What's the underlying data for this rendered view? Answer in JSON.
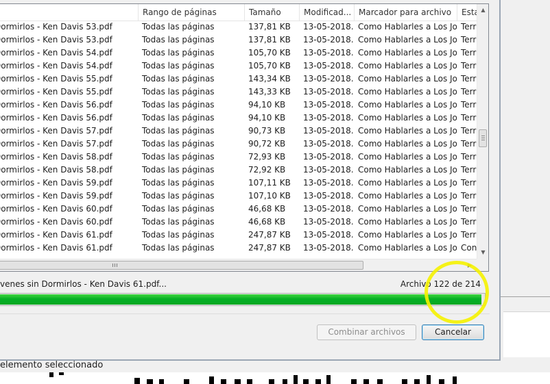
{
  "columns": [
    {
      "label": ""
    },
    {
      "label": "Rango de páginas"
    },
    {
      "label": "Tamaño"
    },
    {
      "label": "Modificad..."
    },
    {
      "label": "Marcador para archivo"
    },
    {
      "label": "Esta"
    }
  ],
  "rows": [
    {
      "name": "Dormirlos - Ken Davis 53.pdf",
      "range": "Todas las páginas",
      "size": "137,81 KB",
      "modified": "13-05-2018...",
      "bookmark": "Como Hablarles a Los Jo...",
      "state": "Terr"
    },
    {
      "name": "Dormirlos - Ken Davis 53.pdf",
      "range": "Todas las páginas",
      "size": "137,81 KB",
      "modified": "13-05-2018...",
      "bookmark": "Como Hablarles a Los Jo...",
      "state": "Terr"
    },
    {
      "name": "Dormirlos - Ken Davis 54.pdf",
      "range": "Todas las páginas",
      "size": "105,70 KB",
      "modified": "13-05-2018...",
      "bookmark": "Como Hablarles a Los Jo...",
      "state": "Terr"
    },
    {
      "name": "Dormirlos - Ken Davis 54.pdf",
      "range": "Todas las páginas",
      "size": "105,70 KB",
      "modified": "13-05-2018...",
      "bookmark": "Como Hablarles a Los Jo...",
      "state": "Terr"
    },
    {
      "name": "Dormirlos - Ken Davis 55.pdf",
      "range": "Todas las páginas",
      "size": "143,34 KB",
      "modified": "13-05-2018...",
      "bookmark": "Como Hablarles a Los Jo...",
      "state": "Terr"
    },
    {
      "name": "Dormirlos - Ken Davis 55.pdf",
      "range": "Todas las páginas",
      "size": "143,33 KB",
      "modified": "13-05-2018...",
      "bookmark": "Como Hablarles a Los Jo...",
      "state": "Terr"
    },
    {
      "name": "Dormirlos - Ken Davis 56.pdf",
      "range": "Todas las páginas",
      "size": "94,10 KB",
      "modified": "13-05-2018...",
      "bookmark": "Como Hablarles a Los Jo...",
      "state": "Terr"
    },
    {
      "name": "Dormirlos - Ken Davis 56.pdf",
      "range": "Todas las páginas",
      "size": "94,10 KB",
      "modified": "13-05-2018...",
      "bookmark": "Como Hablarles a Los Jo...",
      "state": "Terr"
    },
    {
      "name": "Dormirlos - Ken Davis 57.pdf",
      "range": "Todas las páginas",
      "size": "90,73 KB",
      "modified": "13-05-2018...",
      "bookmark": "Como Hablarles a Los Jo...",
      "state": "Terr"
    },
    {
      "name": "Dormirlos - Ken Davis 57.pdf",
      "range": "Todas las páginas",
      "size": "90,72 KB",
      "modified": "13-05-2018...",
      "bookmark": "Como Hablarles a Los Jo...",
      "state": "Terr"
    },
    {
      "name": "Dormirlos - Ken Davis 58.pdf",
      "range": "Todas las páginas",
      "size": "72,93 KB",
      "modified": "13-05-2018...",
      "bookmark": "Como Hablarles a Los Jo...",
      "state": "Terr"
    },
    {
      "name": "Dormirlos - Ken Davis 58.pdf",
      "range": "Todas las páginas",
      "size": "72,92 KB",
      "modified": "13-05-2018...",
      "bookmark": "Como Hablarles a Los Jo...",
      "state": "Terr"
    },
    {
      "name": "Dormirlos - Ken Davis 59.pdf",
      "range": "Todas las páginas",
      "size": "107,11 KB",
      "modified": "13-05-2018...",
      "bookmark": "Como Hablarles a Los Jo...",
      "state": "Terr"
    },
    {
      "name": "Dormirlos - Ken Davis 59.pdf",
      "range": "Todas las páginas",
      "size": "107,10 KB",
      "modified": "13-05-2018...",
      "bookmark": "Como Hablarles a Los Jo...",
      "state": "Terr"
    },
    {
      "name": "Dormirlos - Ken Davis 60.pdf",
      "range": "Todas las páginas",
      "size": "46,68 KB",
      "modified": "13-05-2018...",
      "bookmark": "Como Hablarles a Los Jo...",
      "state": "Terr"
    },
    {
      "name": "Dormirlos - Ken Davis 60.pdf",
      "range": "Todas las páginas",
      "size": "46,68 KB",
      "modified": "13-05-2018...",
      "bookmark": "Como Hablarles a Los Jo...",
      "state": "Terr"
    },
    {
      "name": "Dormirlos - Ken Davis 61.pdf",
      "range": "Todas las páginas",
      "size": "247,87 KB",
      "modified": "13-05-2018...",
      "bookmark": "Como Hablarles a Los Jo...",
      "state": "Terr"
    },
    {
      "name": "Dormirlos - Ken Davis 61.pdf",
      "range": "Todas las páginas",
      "size": "247,87 KB",
      "modified": "13-05-2018...",
      "bookmark": "Como Hablarles a Los Jo...",
      "state": "Con"
    }
  ],
  "status": {
    "current_file": "venes sin Dormirlos - Ken Davis 61.pdf...",
    "counter": "Archivo 122 de 214",
    "progress_fraction": 0.995
  },
  "buttons": {
    "combine_label": "Combinar archivos",
    "cancel_label": "Cancelar"
  },
  "footer": {
    "selection_text": "elemento seleccionado"
  },
  "colors": {
    "progress_fill": "#06b025",
    "annotation": "#f5f200"
  },
  "icons": {
    "scroll_up": "triangle-up",
    "scroll_down": "triangle-down",
    "scroll_right": "triangle-right"
  }
}
